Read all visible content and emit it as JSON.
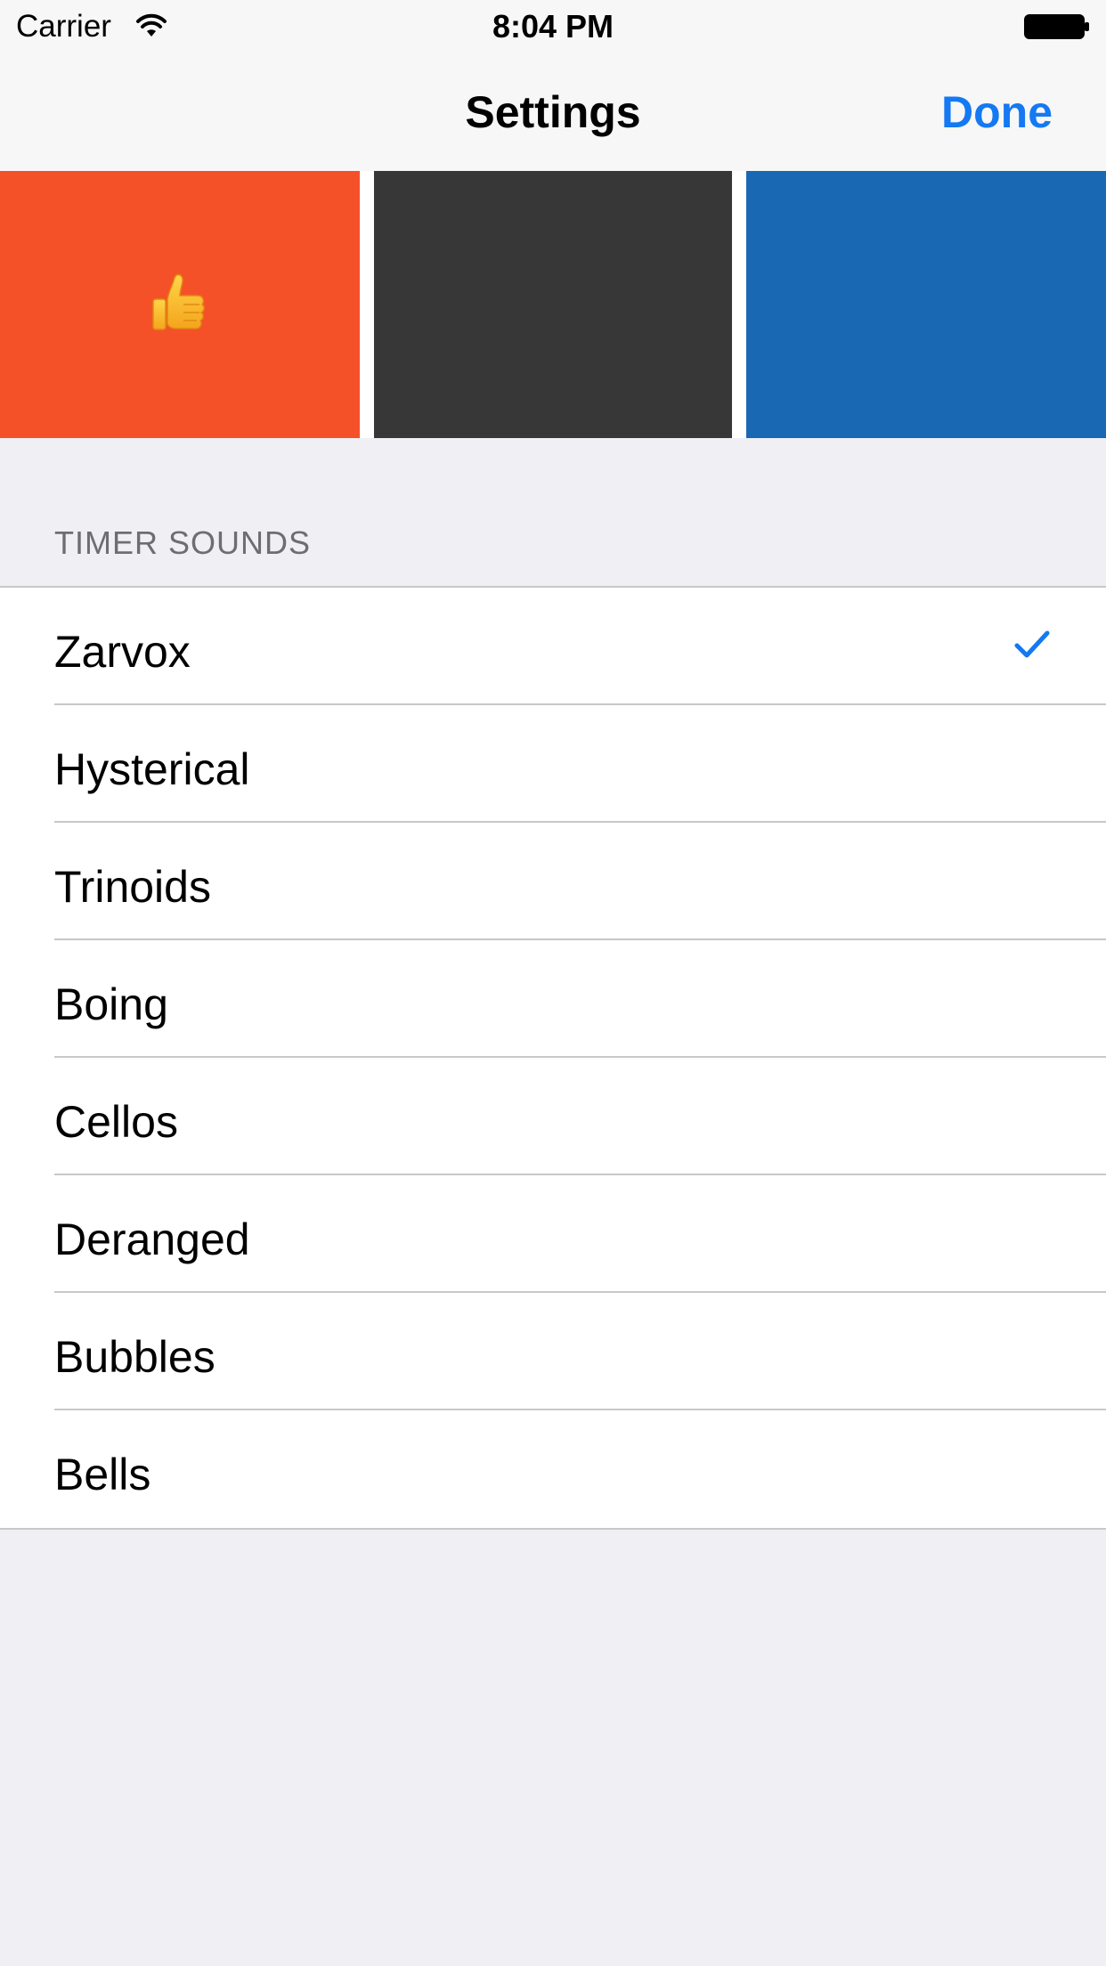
{
  "status_bar": {
    "carrier": "Carrier",
    "time": "8:04 PM",
    "wifi_icon": "wifi-icon",
    "battery_icon": "battery-icon"
  },
  "nav": {
    "title": "Settings",
    "done_label": "Done"
  },
  "colors": {
    "accent": "#1479f2",
    "swatch_orange": "#f55128",
    "swatch_dark": "#383738",
    "swatch_blue": "#1868b3",
    "background": "#efeff4"
  },
  "swatches": [
    {
      "color": "#f55128",
      "icon": "thumbs-up-icon",
      "selected": true
    },
    {
      "color": "#383738",
      "selected": false
    },
    {
      "color": "#1868b3",
      "selected": false
    }
  ],
  "timer_sounds": {
    "header": "TIMER SOUNDS",
    "items": [
      {
        "label": "Zarvox",
        "selected": true
      },
      {
        "label": "Hysterical",
        "selected": false
      },
      {
        "label": "Trinoids",
        "selected": false
      },
      {
        "label": "Boing",
        "selected": false
      },
      {
        "label": "Cellos",
        "selected": false
      },
      {
        "label": "Deranged",
        "selected": false
      },
      {
        "label": "Bubbles",
        "selected": false
      },
      {
        "label": "Bells",
        "selected": false
      }
    ]
  }
}
